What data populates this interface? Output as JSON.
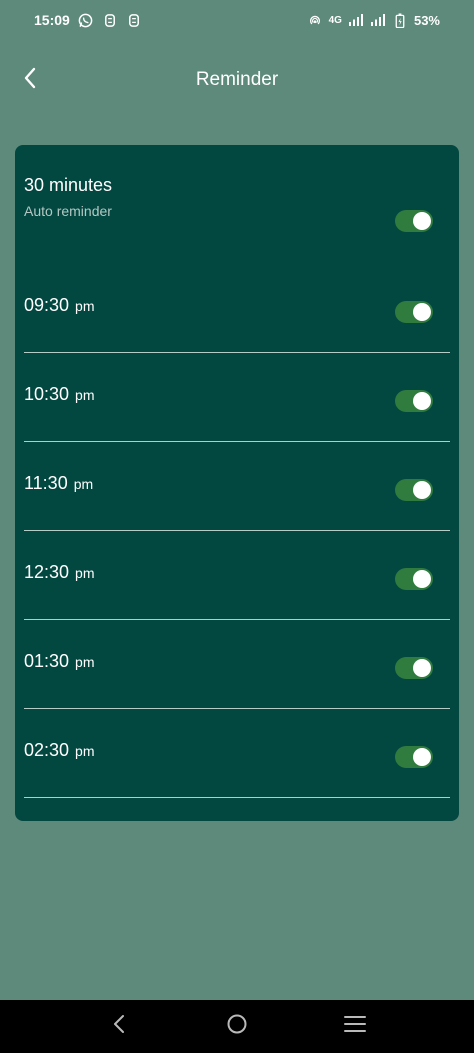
{
  "status_bar": {
    "time": "15:09",
    "network": "4G",
    "battery": "53%"
  },
  "header": {
    "title": "Reminder"
  },
  "auto_reminder": {
    "title": "30 minutes",
    "subtitle": "Auto reminder",
    "enabled": true
  },
  "reminders": [
    {
      "time": "09:30",
      "period": "pm",
      "enabled": true
    },
    {
      "time": "10:30",
      "period": "pm",
      "enabled": true
    },
    {
      "time": "11:30",
      "period": "pm",
      "enabled": true
    },
    {
      "time": "12:30",
      "period": "pm",
      "enabled": true
    },
    {
      "time": "01:30",
      "period": "pm",
      "enabled": true
    },
    {
      "time": "02:30",
      "period": "pm",
      "enabled": true
    }
  ],
  "colors": {
    "background": "#5e8a7b",
    "card": "#034741",
    "toggle_on": "#2f7c3e",
    "divider": "#b6ccc6"
  },
  "icons": {
    "back": "chevron-left-icon",
    "whatsapp": "whatsapp-icon",
    "nav_back": "nav-back-icon",
    "nav_home": "nav-home-icon",
    "nav_menu": "nav-menu-icon"
  }
}
